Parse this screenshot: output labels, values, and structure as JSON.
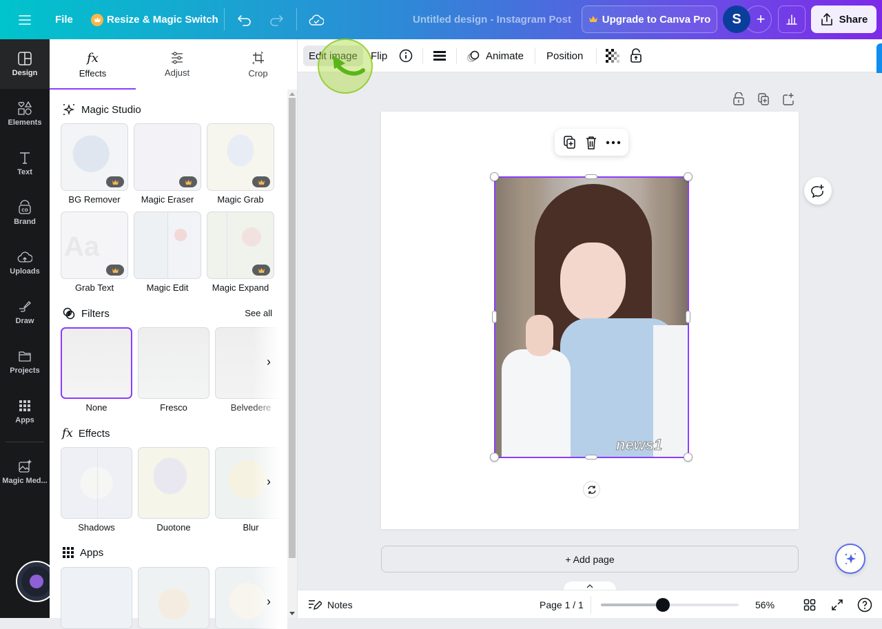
{
  "topbar": {
    "file_label": "File",
    "resize_label": "Resize & Magic Switch",
    "doc_title": "Untitled design - Instagram Post",
    "upgrade_label": "Upgrade to Canva Pro",
    "avatar_initial": "S",
    "add_label": "+",
    "share_label": "Share",
    "brand_gradient": [
      "#00c4cc",
      "#7d2ae8"
    ]
  },
  "rail": {
    "items": [
      {
        "label": "Design",
        "icon": "layout-icon"
      },
      {
        "label": "Elements",
        "icon": "shapes-icon"
      },
      {
        "label": "Text",
        "icon": "text-icon"
      },
      {
        "label": "Brand",
        "icon": "brand-icon"
      },
      {
        "label": "Uploads",
        "icon": "cloud-upload-icon"
      },
      {
        "label": "Draw",
        "icon": "draw-icon"
      },
      {
        "label": "Projects",
        "icon": "folder-icon"
      },
      {
        "label": "Apps",
        "icon": "apps-grid-icon"
      },
      {
        "label": "Magic Med...",
        "icon": "magic-media-icon"
      }
    ]
  },
  "panel": {
    "tabs": [
      {
        "label": "Effects",
        "icon": "fx-icon",
        "active": true
      },
      {
        "label": "Adjust",
        "icon": "sliders-icon",
        "active": false
      },
      {
        "label": "Crop",
        "icon": "crop-icon",
        "active": false
      }
    ],
    "magic_studio": {
      "title": "Magic Studio",
      "tools": [
        {
          "label": "BG Remover",
          "pro": true
        },
        {
          "label": "Magic Eraser",
          "pro": true
        },
        {
          "label": "Magic Grab",
          "pro": true
        },
        {
          "label": "Grab Text",
          "pro": true
        },
        {
          "label": "Magic Edit",
          "pro": false
        },
        {
          "label": "Magic Expand",
          "pro": true
        }
      ]
    },
    "filters": {
      "title": "Filters",
      "see_all": "See all",
      "items": [
        {
          "label": "None",
          "selected": true
        },
        {
          "label": "Fresco",
          "selected": false
        },
        {
          "label": "Belvedere",
          "selected": false
        }
      ]
    },
    "effects": {
      "title": "Effects",
      "items": [
        {
          "label": "Shadows"
        },
        {
          "label": "Duotone"
        },
        {
          "label": "Blur"
        }
      ]
    },
    "apps": {
      "title": "Apps"
    }
  },
  "context_toolbar": {
    "edit_image": "Edit image",
    "flip": "Flip",
    "animate": "Animate",
    "position": "Position"
  },
  "canvas": {
    "photo_watermark": "news1",
    "add_page": "+ Add page",
    "selection_color": "#8b3dff"
  },
  "footer": {
    "notes": "Notes",
    "page_indicator": "Page 1 / 1",
    "zoom_percent": 56,
    "zoom_label": "56%",
    "zoom_slider_fraction": 0.45
  }
}
